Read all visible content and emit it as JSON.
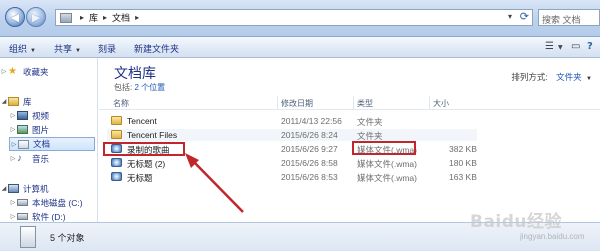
{
  "address_bar": {
    "crumbs": [
      "库",
      "文档"
    ],
    "search_placeholder": "搜索 文档"
  },
  "toolbar": {
    "organize": "组织",
    "share": "共享",
    "burn": "刻录",
    "new_folder": "新建文件夹"
  },
  "nav": {
    "favorites": "收藏夹",
    "libraries": "库",
    "videos": "视频",
    "pictures": "图片",
    "documents": "文档",
    "music": "音乐",
    "computer": "计算机",
    "local_disk": "本地磁盘 (C:)",
    "software": "软件 (D:)"
  },
  "library": {
    "title": "文档库",
    "includes_label": "包括:",
    "includes_link": "2 个位置",
    "arrange_label": "排列方式:",
    "arrange_value": "文件夹"
  },
  "columns": {
    "name": "名称",
    "date": "修改日期",
    "type": "类型",
    "size": "大小"
  },
  "files": [
    {
      "name": "Tencent",
      "date": "2011/4/13 22:56",
      "type": "文件夹",
      "size": "",
      "icon": "folder-icon"
    },
    {
      "name": "Tencent Files",
      "date": "2015/6/26 8:24",
      "type": "文件夹",
      "size": "",
      "icon": "folder-icon"
    },
    {
      "name": "录制的歌曲",
      "date": "2015/6/26 9:27",
      "type": "媒体文件(.wma)",
      "size": "382 KB",
      "icon": "media-file-icon"
    },
    {
      "name": "无标题 (2)",
      "date": "2015/6/26 8:58",
      "type": "媒体文件(.wma)",
      "size": "180 KB",
      "icon": "media-file-icon"
    },
    {
      "name": "无标题",
      "date": "2015/6/26 8:53",
      "type": "媒体文件(.wma)",
      "size": "163 KB",
      "icon": "media-file-icon"
    }
  ],
  "status": {
    "item_count": "5 个对象"
  },
  "watermark": {
    "text": "Baidu经验",
    "url": "jingyan.baidu.com"
  },
  "annotation": {
    "highlight_color": "#c0262b"
  }
}
